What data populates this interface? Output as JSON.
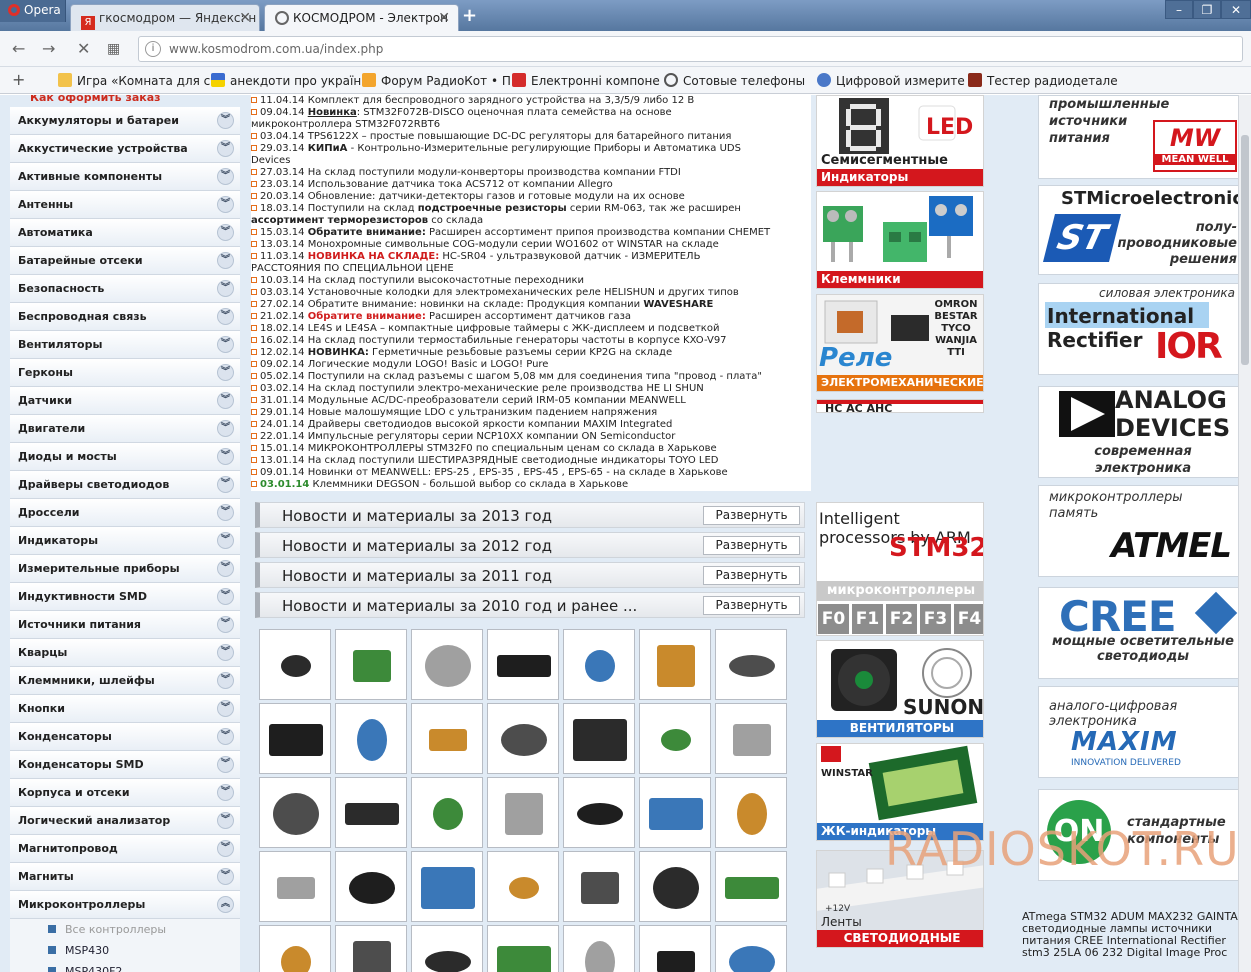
{
  "browser": {
    "opera_label": "Opera",
    "tabs": [
      {
        "title": "гкосмодром — Яндекс: н",
        "active": false
      },
      {
        "title": "КОСМОДРОМ - Электрон",
        "active": true
      }
    ],
    "url": "www.kosmodrom.com.ua/index.php",
    "bookmarks": [
      "Игра «Комната для с",
      "анекдоти про україн",
      "Форум РадиоКот • П",
      "Електронні компоне",
      "Сотовые телефоны",
      "Цифровой измерите",
      "Тестер радиодетале"
    ]
  },
  "sidebar": {
    "cut_top": "Как оформить заказ",
    "categories": [
      "Аккумуляторы и батареи",
      "Аккустические устройства",
      "Активные компоненты",
      "Антенны",
      "Автоматика",
      "Батарейные отсеки",
      "Безопасность",
      "Беспроводная связь",
      "Вентиляторы",
      "Герконы",
      "Датчики",
      "Двигатели",
      "Диоды и мосты",
      "Драйверы светодиодов",
      "Дроссели",
      "Индикаторы",
      "Измерительные приборы",
      "Индуктивности SMD",
      "Источники питания",
      "Кварцы",
      "Клеммники, шлейфы",
      "Кнопки",
      "Конденсаторы",
      "Конденсаторы SMD",
      "Корпуса и отсеки",
      "Логический анализатор",
      "Магнитопровод",
      "Магниты",
      "Микроконтроллеры"
    ],
    "subitems": [
      "Все контроллеры",
      "MSP430",
      "MSP430F2"
    ]
  },
  "news": [
    {
      "d": "11.04.14",
      "pre": "",
      "hl": "",
      "hlc": "",
      "t": "Комплект для беспроводного зарядного устройства на 3,3/5/9 либо 12 В"
    },
    {
      "d": "09.04.14",
      "pre": "",
      "hl": "Новинка",
      "hlc": "u",
      "t": ": STM32F072B-DISCO оценочная плата семейства на основе"
    },
    {
      "d": "",
      "pre": "",
      "hl": "",
      "hlc": "",
      "t": "микроконтроллера STM32F072RBT6"
    },
    {
      "d": "03.04.14",
      "pre": "",
      "hl": "",
      "hlc": "",
      "t": "TPS6122X – простые повышающие DC-DC регуляторы для батарейного питания"
    },
    {
      "d": "29.03.14",
      "pre": "",
      "hl": "КИПиА",
      "hlc": "bl",
      "t": " - Контрольно-Измерительные регулирующие Приборы и Автоматика UDS"
    },
    {
      "d": "",
      "pre": "",
      "hl": "",
      "hlc": "",
      "t": "Devices"
    },
    {
      "d": "27.03.14",
      "pre": "",
      "hl": "",
      "hlc": "",
      "t": "На склад поступили модули-конверторы производства компании FTDI"
    },
    {
      "d": "23.03.14",
      "pre": "",
      "hl": "",
      "hlc": "",
      "t": "Использование датчика тока ACS712 от компании Allegro"
    },
    {
      "d": "20.03.14",
      "pre": "",
      "hl": "",
      "hlc": "",
      "t": "Обновление: датчики-детекторы газов и готовые модули на их основе"
    },
    {
      "d": "18.03.14",
      "pre": "Поступили на склад ",
      "hl": "подстроечные резисторы",
      "hlc": "bl",
      "t": " серии RM-063, так же расширен"
    },
    {
      "d": "",
      "pre": "",
      "hl": "ассортимент терморезисторов",
      "hlc": "bl",
      "t": " со склада"
    },
    {
      "d": "15.03.14",
      "pre": "",
      "hl": "Обратите внимание:",
      "hlc": "bl",
      "t": " Расширен ассортимент припоя производства компании CHEMET"
    },
    {
      "d": "13.03.14",
      "pre": "",
      "hl": "",
      "hlc": "",
      "t": "Монохромные символьные COG-модули серии WO1602 от WINSTAR на складе"
    },
    {
      "d": "11.03.14",
      "pre": "",
      "hl": "НОВИНКА НА СКЛАДЕ:",
      "hlc": "red",
      "t": " HC-SR04 - ультразвуковой датчик - ИЗМЕРИТЕЛЬ"
    },
    {
      "d": "",
      "pre": "",
      "hl": "",
      "hlc": "",
      "t": "РАССТОЯНИЯ ПО СПЕЦИАЛЬНОЙ ЦЕНЕ"
    },
    {
      "d": "10.03.14",
      "pre": "",
      "hl": "",
      "hlc": "",
      "t": "На склад поступили высокочастотные переходники"
    },
    {
      "d": "03.03.14",
      "pre": "",
      "hl": "",
      "hlc": "",
      "t": "Установочные колодки для электромеханических реле HELISHUN и других типов"
    },
    {
      "d": "27.02.14",
      "pre": "Обратите внимание: новинки на складе: Продукция компании ",
      "hl": "WAVESHARE",
      "hlc": "bl",
      "t": ""
    },
    {
      "d": "21.02.14",
      "pre": "",
      "hl": "Обратите внимание:",
      "hlc": "red",
      "t": " Расширен ассортимент датчиков газа"
    },
    {
      "d": "18.02.14",
      "pre": "",
      "hl": "",
      "hlc": "",
      "t": "LE4S и LE4SA – компактные цифровые таймеры с ЖК-дисплеем и подсветкой"
    },
    {
      "d": "16.02.14",
      "pre": "",
      "hl": "",
      "hlc": "",
      "t": "На склад поступили термостабильные генераторы частоты в корпусе KXO-V97"
    },
    {
      "d": "12.02.14",
      "pre": "",
      "hl": "НОВИНКА:",
      "hlc": "bl",
      "t": " Герметичные резьбовые разъемы серии KP2G на складе"
    },
    {
      "d": "09.02.14",
      "pre": "",
      "hl": "",
      "hlc": "",
      "t": "Логические модули LOGO! Basic и LOGO! Pure"
    },
    {
      "d": "05.02.14",
      "pre": "",
      "hl": "",
      "hlc": "",
      "t": "Поступили на склад разъемы с шагом 5,08 мм для соединения типа \"провод - плата\""
    },
    {
      "d": "03.02.14",
      "pre": "",
      "hl": "",
      "hlc": "",
      "t": "На склад поступили электро-механические реле производства HE LI SHUN"
    },
    {
      "d": "31.01.14",
      "pre": "",
      "hl": "",
      "hlc": "",
      "t": "Модульные AC/DC-преобразователи серий IRM-05 компании MEANWELL"
    },
    {
      "d": "29.01.14",
      "pre": "",
      "hl": "",
      "hlc": "",
      "t": "Новые малошумящие LDO с ультранизким падением напряжения"
    },
    {
      "d": "24.01.14",
      "pre": "",
      "hl": "",
      "hlc": "",
      "t": "Драйверы светодиодов высокой яркости компании MAXIM Integrated"
    },
    {
      "d": "22.01.14",
      "pre": "",
      "hl": "",
      "hlc": "",
      "t": "Импульсные регуляторы серии NCP10XX компании ON Semiconductor"
    },
    {
      "d": "15.01.14",
      "pre": "",
      "hl": "",
      "hlc": "",
      "t": "МИКРОКОНТРОЛЛЕРЫ STM32F0 по специальным ценам со склада в Харькове"
    },
    {
      "d": "13.01.14",
      "pre": "",
      "hl": "",
      "hlc": "",
      "t": "На склад поступили ШЕСТИРАЗРЯДНЫЕ светодиодные индикаторы TOYO LED"
    },
    {
      "d": "09.01.14",
      "pre": "",
      "hl": "",
      "hlc": "",
      "t": "Новинки от MEANWELL: EPS-25 , EPS-35 , EPS-45 , EPS-65 - на складе в Харькове"
    },
    {
      "d": "03.01.14",
      "pre": "",
      "hl": "",
      "hlc": "",
      "t": "Клеммники DEGSON - большой выбор со склада в Харькове",
      "green": true
    }
  ],
  "year_sections": [
    {
      "title": "Новости и материалы за 2013 год",
      "button": "Развернуть"
    },
    {
      "title": "Новости и материалы за 2012 год",
      "button": "Развернуть"
    },
    {
      "title": "Новости и материалы за 2011 год",
      "button": "Развернуть"
    },
    {
      "title": "Новости и материалы за 2010 год и ранее ...",
      "button": "Развернуть"
    }
  ],
  "mid_banners": {
    "seg_title": "Семисегментные",
    "seg_bar": "Индикаторы",
    "klem_bar": "Клеммники",
    "rele_title": "Реле",
    "rele_brands": [
      "OMRON",
      "BESTAR",
      "TYCO",
      "WANJIA",
      "TTI"
    ],
    "rele_bar": "ЭЛЕКТРОМЕХАНИЧЕСКИЕ",
    "cut_text": "HC AC AHC",
    "arm_title": "Intelligent processors by ARM",
    "stm32": "STM32",
    "mcu_label": "микроконтроллеры",
    "families": [
      "F0",
      "F1",
      "F2",
      "F3",
      "F4"
    ],
    "sunon": "SUNON",
    "fan_bar": "ВЕНТИЛЯТОРЫ",
    "winstar": "WINSTAR",
    "lcd_bar": "ЖК-индикаторы",
    "strip_label": "Ленты",
    "strip_bar": "СВЕТОДИОДНЫЕ",
    "strip_voltage": "+12V"
  },
  "right_banners": {
    "mw_text": "промышленные источники питания",
    "mw_logo": "MEAN WELL",
    "st_name": "STMicroelectronics",
    "st_text": "полу-проводниковые решения",
    "ir_top": "силовая электроника",
    "ir_name1": "International",
    "ir_name2": "Rectifier",
    "ir_logo": "IOR",
    "ad_name1": "ANALOG",
    "ad_name2": "DEVICES",
    "ad_text": "современная электроника",
    "atmel_text": "микроконтроллеры память",
    "atmel_logo": "ATMEL",
    "cree_logo": "CREE",
    "cree_text": "мощные осветительные светодиоды",
    "maxim_text": "аналого-цифровая электроника",
    "maxim_logo": "MAXIM",
    "maxim_sub": "INNOVATION DELIVERED",
    "on_logo": "ON",
    "on_text": "стандартные компоненты"
  },
  "bottom_text": "ATmega STM32 ADUM MAX232 GAINTA светодиодные лампы источники питания CREE International Rectifier stm3 25LA 06 232 Digital Image Proc",
  "watermark": "RADIOSKOT.RU",
  "colors": {
    "accent_red": "#d4171d",
    "page_bg": "#e1ebf5",
    "link_orange": "#e46e1c"
  }
}
